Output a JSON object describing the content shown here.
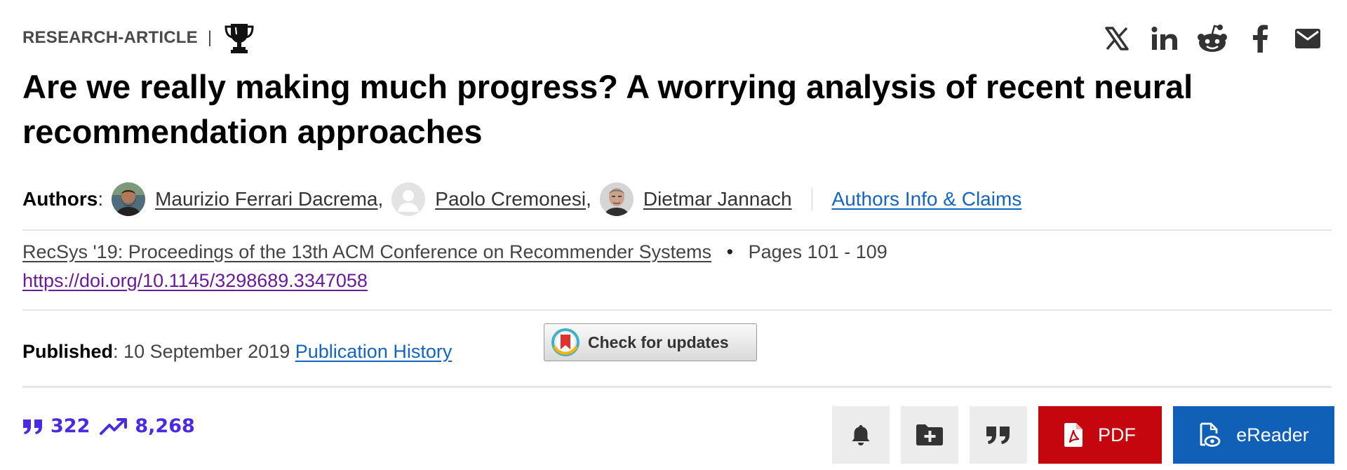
{
  "article_type": "RESEARCH-ARTICLE",
  "separator": "|",
  "award_icon": "trophy-icon",
  "share": {
    "icons": [
      "x-twitter-icon",
      "linkedin-icon",
      "reddit-icon",
      "facebook-icon",
      "email-icon"
    ]
  },
  "title": "Are we really making much progress? A worrying analysis of recent neural recommendation approaches",
  "authors": {
    "label": "Authors",
    "colon": ":",
    "list": [
      {
        "name": "Maurizio Ferrari Dacrema",
        "suffix": ","
      },
      {
        "name": "Paolo Cremonesi",
        "suffix": ","
      },
      {
        "name": "Dietmar Jannach",
        "suffix": ""
      }
    ],
    "info_link": "Authors Info & Claims"
  },
  "proceedings": {
    "name": "RecSys '19: Proceedings of the 13th ACM Conference on Recommender Systems",
    "bullet": "•",
    "pages": "Pages 101 - 109"
  },
  "doi": "https://doi.org/10.1145/3298689.3347058",
  "published": {
    "label": "Published",
    "colon": ":",
    "date": "10 September 2019",
    "history_link": "Publication History"
  },
  "check_updates": {
    "label": "Check for updates"
  },
  "metrics": {
    "citations": "322",
    "downloads": "8,268"
  },
  "actions": {
    "pdf_label": "PDF",
    "ereader_label": "eReader"
  },
  "colors": {
    "pdf": "#c6060e",
    "ereader": "#1060b8",
    "metrics": "#4a2be0",
    "link": "#1565c0",
    "doi": "#6a1b9a"
  }
}
